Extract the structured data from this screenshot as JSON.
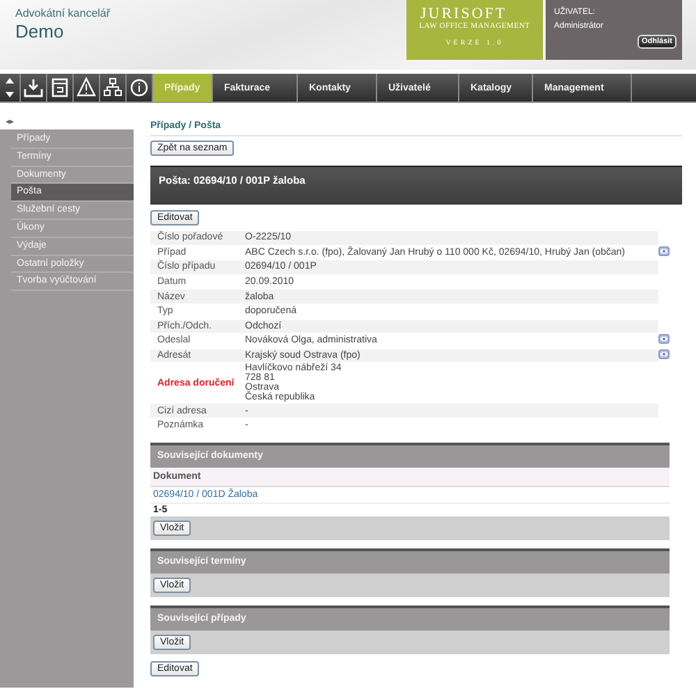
{
  "header": {
    "office_label": "Advokátní kancelář",
    "office_name": "Demo",
    "product": "JURISOFT",
    "product_subtitle": "LAW OFFICE MANAGEMENT",
    "version": "VERZE 1.0",
    "user_label": "UŽIVATEL:",
    "user_name": "Administrátor",
    "logout": "Odhlásit"
  },
  "toolbar": [
    {
      "kind": "updown"
    },
    {
      "kind": "download"
    },
    {
      "kind": "calendar"
    },
    {
      "kind": "warning"
    },
    {
      "kind": "sitemap"
    },
    {
      "kind": "info"
    }
  ],
  "tabs": [
    {
      "label": "Případy",
      "selected": true
    },
    {
      "label": "Fakturace",
      "selected": false
    },
    {
      "label": "Kontakty",
      "selected": false
    },
    {
      "label": "Uživatelé",
      "selected": false
    },
    {
      "label": "Katalogy",
      "selected": false
    },
    {
      "label": "Management",
      "selected": false
    }
  ],
  "sidebar": {
    "toggle": "◂▸",
    "items": [
      {
        "label": "Případy",
        "selected": false
      },
      {
        "label": "Termíny",
        "selected": false
      },
      {
        "label": "Dokumenty",
        "selected": false
      },
      {
        "label": "Pošta",
        "selected": true
      },
      {
        "label": "Služební cesty",
        "selected": false
      },
      {
        "label": "Úkony",
        "selected": false
      },
      {
        "label": "Výdaje",
        "selected": false
      },
      {
        "label": "Ostatní položky",
        "selected": false
      },
      {
        "label": "Tvorba vyúčtování",
        "selected": false
      }
    ]
  },
  "breadcrumb": "Případy / Pošta",
  "back_button": "Zpět na seznam",
  "title": "Pošta: 02694/10 / 001P žaloba",
  "edit_button_top": "Editovat",
  "fields": [
    {
      "label": "Číslo pořadové",
      "value": "O-2225/10",
      "highlight": false,
      "detail_link": false
    },
    {
      "label": "Případ",
      "value": "ABC Czech s.r.o. (fpo), Žalovaný Jan Hrubý o 110 000 Kč, 02694/10, Hrubý Jan (občan)",
      "highlight": false,
      "detail_link": true
    },
    {
      "label": "Číslo případu",
      "value": "02694/10 / 001P",
      "highlight": false,
      "detail_link": false
    },
    {
      "label": "Datum",
      "value": "20.09.2010",
      "highlight": false,
      "detail_link": false
    },
    {
      "label": "Název",
      "value": "žaloba",
      "highlight": false,
      "detail_link": false
    },
    {
      "label": "Typ",
      "value": "doporučená",
      "highlight": false,
      "detail_link": false
    },
    {
      "label": "Přích./Odch.",
      "value": "Odchozí",
      "highlight": false,
      "detail_link": false
    },
    {
      "label": "Odeslal",
      "value": "Nováková Olga, administrativa",
      "highlight": false,
      "detail_link": true
    },
    {
      "label": "Adresát",
      "value": "Krajský soud Ostrava (fpo)",
      "highlight": false,
      "detail_link": true
    },
    {
      "label": "Adresa doručení",
      "value": "Havlíčkovo nábřeží 34\n728 81\nOstrava\nČeská republika",
      "highlight": true,
      "detail_link": false
    },
    {
      "label": "Cizí adresa",
      "value": "-",
      "highlight": false,
      "detail_link": false
    },
    {
      "label": "Poznámka",
      "value": "-",
      "highlight": false,
      "detail_link": false
    }
  ],
  "sections": [
    {
      "title": "Související dokumenty",
      "column": "Dokument",
      "rows": [
        "02694/10 / 001D Žaloba"
      ],
      "pager": "1-5",
      "button": "Vložit"
    },
    {
      "title": "Související termíny",
      "button": "Vložit"
    },
    {
      "title": "Související případy",
      "button": "Vložit"
    }
  ],
  "edit_button_bottom": "Editovat"
}
